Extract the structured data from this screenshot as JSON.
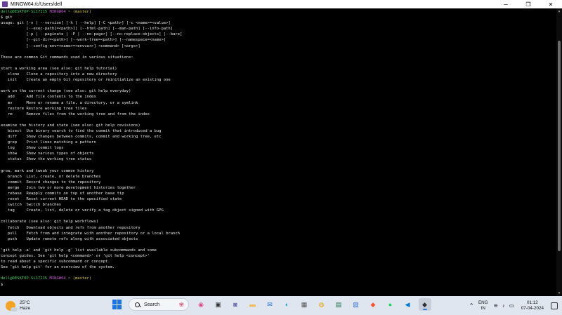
{
  "window": {
    "title": "MINGW64:/c/Users/dell",
    "controls": {
      "minimize": "─",
      "maximize": "❐",
      "close": "✕"
    }
  },
  "terminal": {
    "prompt1": {
      "user": "dell@DESKTOP-SL17I15",
      "env": "MINGW64",
      "path": "~ (master)"
    },
    "command": "$ git",
    "usage": [
      "usage: git [-v | --version] [-h | --help] [-C <path>] [-c <name>=<value>]",
      "           [--exec-path[=<path>]] [--html-path] [--man-path] [--info-path]",
      "           [-p | --paginate | -P | --no-pager] [--no-replace-objects] [--bare]",
      "           [--git-dir=<path>] [--work-tree=<path>] [--namespace=<name>]",
      "           [--config-env=<name>=<envvar>] <command> [<args>]"
    ],
    "intro": "These are common Git commands used in various situations:",
    "sections": [
      {
        "heading": "start a working area (see also: git help tutorial)",
        "commands": [
          {
            "name": "clone",
            "desc": "Clone a repository into a new directory"
          },
          {
            "name": "init",
            "desc": "Create an empty Git repository or reinitialize an existing one"
          }
        ]
      },
      {
        "heading": "work on the current change (see also: git help everyday)",
        "commands": [
          {
            "name": "add",
            "desc": "Add file contents to the index"
          },
          {
            "name": "mv",
            "desc": "Move or rename a file, a directory, or a symlink"
          },
          {
            "name": "restore",
            "desc": "Restore working tree files"
          },
          {
            "name": "rm",
            "desc": "Remove files from the working tree and from the index"
          }
        ]
      },
      {
        "heading": "examine the history and state (see also: git help revisions)",
        "commands": [
          {
            "name": "bisect",
            "desc": "Use binary search to find the commit that introduced a bug"
          },
          {
            "name": "diff",
            "desc": "Show changes between commits, commit and working tree, etc"
          },
          {
            "name": "grep",
            "desc": "Print lines matching a pattern"
          },
          {
            "name": "log",
            "desc": "Show commit logs"
          },
          {
            "name": "show",
            "desc": "Show various types of objects"
          },
          {
            "name": "status",
            "desc": "Show the working tree status"
          }
        ]
      },
      {
        "heading": "grow, mark and tweak your common history",
        "commands": [
          {
            "name": "branch",
            "desc": "List, create, or delete branches"
          },
          {
            "name": "commit",
            "desc": "Record changes to the repository"
          },
          {
            "name": "merge",
            "desc": "Join two or more development histories together"
          },
          {
            "name": "rebase",
            "desc": "Reapply commits on top of another base tip"
          },
          {
            "name": "reset",
            "desc": "Reset current HEAD to the specified state"
          },
          {
            "name": "switch",
            "desc": "Switch branches"
          },
          {
            "name": "tag",
            "desc": "Create, list, delete or verify a tag object signed with GPG"
          }
        ]
      },
      {
        "heading": "collaborate (see also: git help workflows)",
        "commands": [
          {
            "name": "fetch",
            "desc": "Download objects and refs from another repository"
          },
          {
            "name": "pull",
            "desc": "Fetch from and integrate with another repository or a local branch"
          },
          {
            "name": "push",
            "desc": "Update remote refs along with associated objects"
          }
        ]
      }
    ],
    "footer": [
      "'git help -a' and 'git help -g' list available subcommands and some",
      "concept guides. See 'git help <command>' or 'git help <concept>'",
      "to read about a specific subcommand or concept.",
      "See 'git help git' for an overview of the system."
    ],
    "prompt2": {
      "user": "dell@DESKTOP-SL17I15",
      "env": "MINGW64",
      "path": "~ (master)"
    },
    "cursor_line": "$"
  },
  "taskbar": {
    "weather": {
      "temp": "25°C",
      "condition": "Haze"
    },
    "search_label": "Search",
    "apps": [
      {
        "icon": "meet-icon",
        "glyph": "◉",
        "color": "#e04b8c"
      },
      {
        "icon": "taskview-icon",
        "glyph": "▣",
        "color": "#333333"
      },
      {
        "icon": "teams-icon",
        "glyph": "◙",
        "color": "#6264a7"
      },
      {
        "icon": "file-explorer-icon",
        "glyph": "▬",
        "color": "#f2b84b"
      },
      {
        "icon": "mail-icon",
        "glyph": "✉",
        "color": "#1a6fd6"
      },
      {
        "icon": "edge-icon",
        "glyph": "◐",
        "color": "#1c9ad6"
      },
      {
        "icon": "calculator-icon",
        "glyph": "▦",
        "color": "#555555"
      },
      {
        "icon": "chrome-icon",
        "glyph": "◍",
        "color": "#e2a400"
      },
      {
        "icon": "excel-icon",
        "glyph": "▤",
        "color": "#1e7145"
      },
      {
        "icon": "photos-icon",
        "glyph": "▧",
        "color": "#3873d6"
      },
      {
        "icon": "brave-icon",
        "glyph": "◆",
        "color": "#fb542b"
      },
      {
        "icon": "whatsapp-icon",
        "glyph": "●",
        "color": "#25d366"
      },
      {
        "icon": "vscode-icon",
        "glyph": "◀",
        "color": "#0078d4"
      },
      {
        "icon": "git-bash-icon",
        "glyph": "◆",
        "color": "#2f2f2f"
      }
    ],
    "tray": {
      "chevron": "^",
      "lang_top": "ENG",
      "lang_bottom": "IN",
      "wifi": "≋",
      "volume": "♪",
      "battery": "▭",
      "time": "01:12",
      "date": "07-04-2024"
    }
  }
}
